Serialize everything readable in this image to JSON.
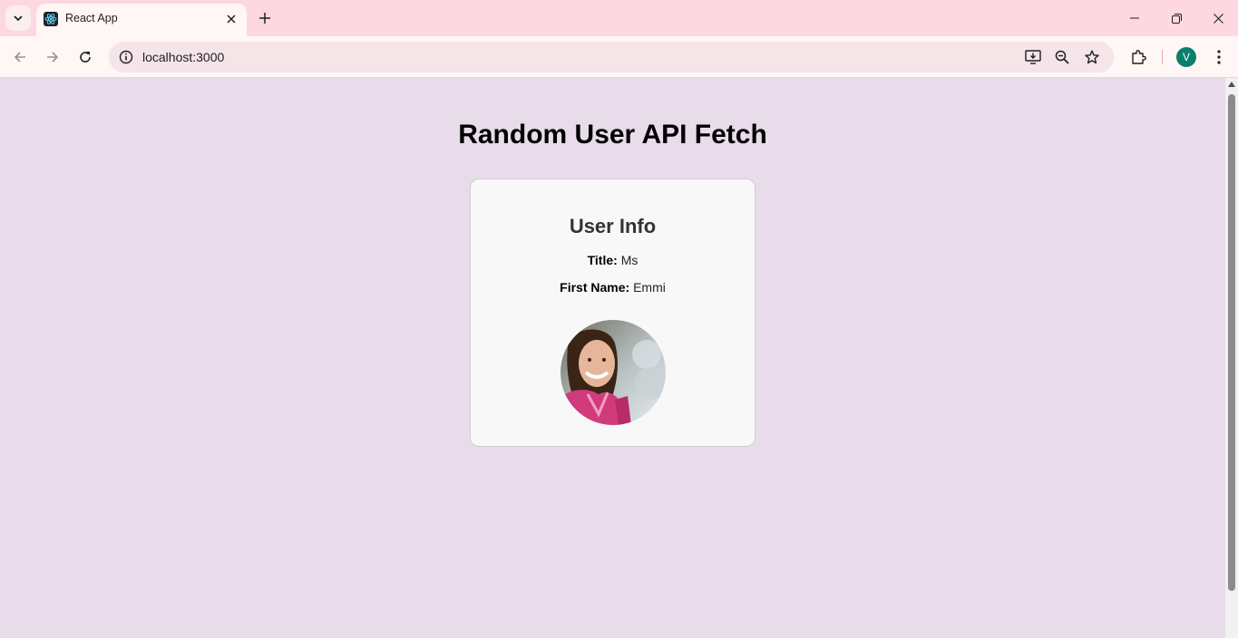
{
  "browser": {
    "tab": {
      "title": "React App",
      "favicon": "react-icon"
    },
    "url": "localhost:3000",
    "profile_initial": "V",
    "icons": [
      "tab-search-icon",
      "close-icon",
      "plus-icon",
      "minimize-icon",
      "restore-icon",
      "back-icon",
      "forward-icon",
      "reload-icon",
      "site-info-icon",
      "install-app-icon",
      "zoom-icon",
      "bookmark-star-icon",
      "extensions-icon",
      "more-icon"
    ]
  },
  "page": {
    "heading": "Random User API Fetch",
    "card": {
      "title": "User Info",
      "fields": [
        {
          "label": "Title:",
          "value": "Ms"
        },
        {
          "label": "First Name:",
          "value": "Emmi"
        }
      ],
      "photo": "user-portrait"
    }
  },
  "colors": {
    "tabstrip": "#fdd8e0",
    "toolbar": "#fff6f6",
    "page_background": "#e8dbea",
    "card_background": "#f8f8f8",
    "avatar": "#0b7f6b"
  }
}
